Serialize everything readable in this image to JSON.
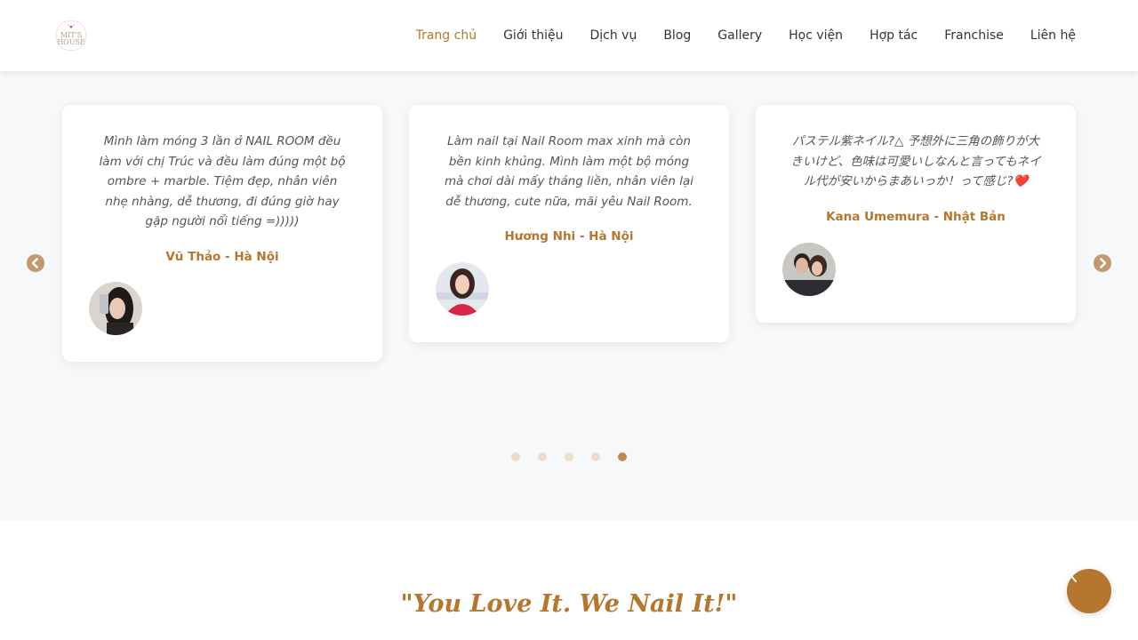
{
  "brand": {
    "logo_text": "MIT'S HOUSE",
    "accent_color": "#b4772d"
  },
  "nav": {
    "items": [
      {
        "label": "Trang chủ",
        "active": true
      },
      {
        "label": "Giới thiệu",
        "active": false
      },
      {
        "label": "Dịch vụ",
        "active": false
      },
      {
        "label": "Blog",
        "active": false
      },
      {
        "label": "Gallery",
        "active": false
      },
      {
        "label": "Học viện",
        "active": false
      },
      {
        "label": "Hợp tác",
        "active": false
      },
      {
        "label": "Franchise",
        "active": false
      },
      {
        "label": "Liên hệ",
        "active": false
      }
    ]
  },
  "testimonials": {
    "cards": [
      {
        "quote": "Mình làm móng 3 lần ở NAIL ROOM đều làm với chị Trúc và đều làm đúng một bộ ombre + marble. Tiệm đẹp, nhân viên nhẹ nhàng, dễ thương, đi đúng giờ hay gặp người nổi tiếng =)))))",
        "author": "Vũ Thảo - Hà Nội"
      },
      {
        "quote": "Làm nail tại Nail Room max xinh mà còn bền kinh khủng. Mình làm một bộ móng mà chơi dài mấy tháng liền, nhân viên lại dễ thương, cute nữa, mãi yêu Nail Room.",
        "author": "Hương Nhi - Hà Nội"
      },
      {
        "quote": "パステル紫ネイル?△ 予想外に三角の飾りが大きいけど、色味は可愛いしなんと言ってもネイル代が安いからまあいっか！って感じ?❤️",
        "author": "Kana Umemura - Nhật Bản"
      }
    ],
    "prev_icon": "chevron-left-circle-icon",
    "next_icon": "chevron-right-circle-icon",
    "pagination": {
      "total": 5,
      "active_index": 4
    }
  },
  "slogan": "\"You Love It. We Nail It!\"",
  "fab_icon": "chevron-up-icon"
}
